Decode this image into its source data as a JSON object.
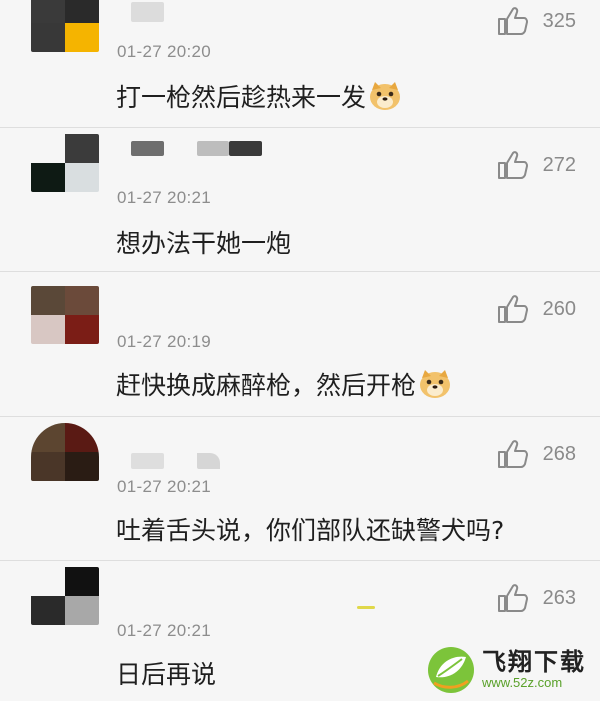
{
  "comments": [
    {
      "time": "01-27 20:20",
      "text": "打一枪然后趁热来一发",
      "likes": "325",
      "emoji": "doge-emoji",
      "avatar_colors": [
        "#3a3a3a",
        "#2a2a2a",
        "#383838",
        "#f5b400"
      ]
    },
    {
      "time": "01-27 20:21",
      "text": "想办法干她一炮",
      "likes": "272",
      "emoji": "",
      "avatar_colors": [
        "#f6f6f6",
        "#3b3b3b",
        "#0e1a14",
        "#d9dee0"
      ]
    },
    {
      "time": "01-27 20:19",
      "text": "赶快换成麻醉枪，然后开枪",
      "likes": "260",
      "emoji": "doge-emoji",
      "avatar_colors": [
        "#5a4838",
        "#6b4a3a",
        "#d8c7c3",
        "#7b1d16"
      ]
    },
    {
      "time": "01-27 20:21",
      "text": "吐着舌头说，你们部队还缺警犬吗?",
      "likes": "268",
      "emoji": "",
      "avatar_colors": [
        "#5c4530",
        "#5a1a14",
        "#4a3628",
        "#2a1c14"
      ]
    },
    {
      "time": "01-27 20:21",
      "text": "日后再说",
      "likes": "263",
      "emoji": "",
      "avatar_colors": [
        "#f6f6f6",
        "#111111",
        "#2a2a2a",
        "#a8a8a8"
      ]
    }
  ],
  "watermark": {
    "title": "飞翔下载",
    "url": "www.52z.com",
    "icon": "leaf-logo-icon"
  },
  "colors": {
    "background": "#f6f6f6",
    "divider": "#dedede",
    "time": "#8d8d8d",
    "text": "#1f1f1f",
    "brand_green": "#5aa12a"
  }
}
